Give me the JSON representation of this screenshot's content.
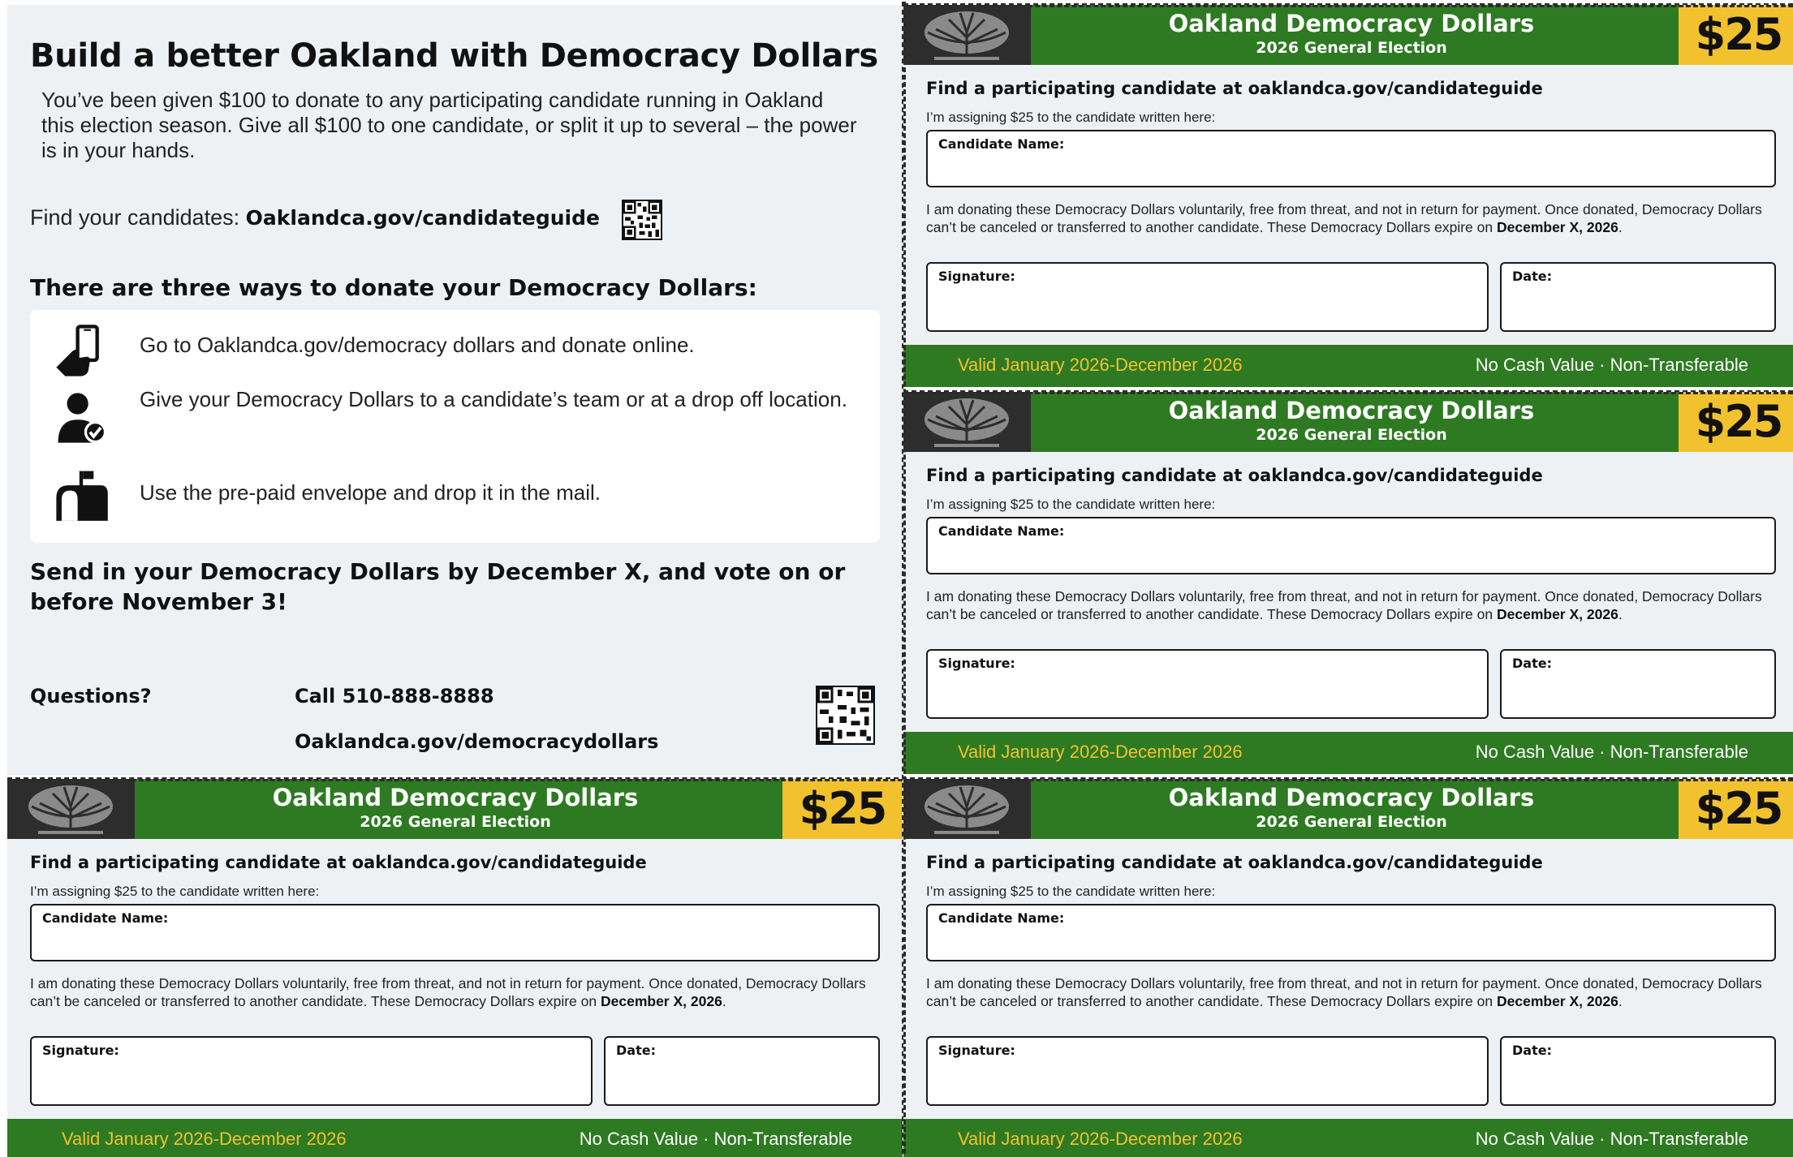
{
  "intro": {
    "title": "Build a better Oakland with Democracy Dollars",
    "paragraph": "You’ve been given $100 to donate to any participating candidate running in Oakland this election season. Give all $100 to one candidate, or split it up to several – the power is in your hands.",
    "find_label": "Find your candidates: ",
    "find_link": "Oaklandca.gov/candidateguide",
    "ways_heading": "There are three ways to donate your Democracy Dollars:",
    "ways": [
      {
        "icon": "phone-hand-icon",
        "text": "Go to Oaklandca.gov/democracy dollars and donate online."
      },
      {
        "icon": "person-check-icon",
        "text": "Give your Democracy Dollars to a candidate’s team or at a drop off location."
      },
      {
        "icon": "mailbox-icon",
        "text": "Use the pre-paid envelope and drop it in the mail."
      }
    ],
    "send_line": "Send in your Democracy Dollars by December X, and vote on or before November 3!",
    "questions_label": "Questions?",
    "call": "Call 510-888-8888",
    "site": "Oaklandca.gov/democracydollars"
  },
  "voucher": {
    "title": "Oakland Democracy Dollars",
    "subtitle": "2026 General Election",
    "amount": "$25",
    "find": "Find a participating candidate at oaklandca.gov/candidateguide",
    "assign": "I’m assigning $25 to the candidate written here:",
    "candidate_label": "Candidate Name:",
    "declaration": "I am donating these Democracy Dollars voluntarily, free from threat, and not in return for payment. Once donated, Democracy Dollars can’t be canceled or transferred to another candidate. These Democracy Dollars expire on ",
    "expiry": "December X, 2026",
    "signature_label": "Signature:",
    "date_label": "Date:",
    "valid": "Valid January 2026-December 2026",
    "no_cash": "No Cash Value · Non-Transferable"
  },
  "colors": {
    "green": "#2e7a22",
    "gold": "#f2c12e",
    "panel": "#edf1f3",
    "logo_bg": "#2d2d2d"
  }
}
